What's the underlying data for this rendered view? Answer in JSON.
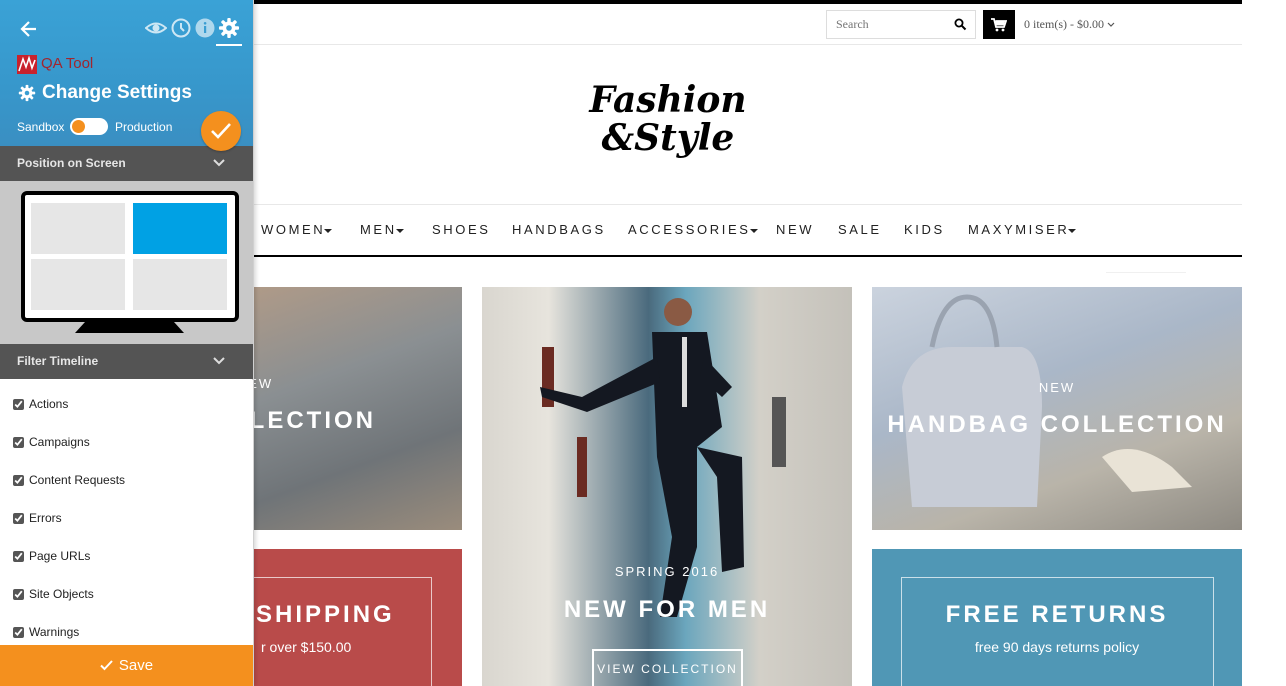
{
  "site": {
    "search_placeholder": "Search",
    "cart_summary": "0 item(s) - $0.00",
    "logo_line1": "Fashion",
    "logo_line2": "&Style",
    "nav": [
      "WOMEN",
      "MEN",
      "SHOES",
      "HANDBAGS",
      "ACCESSORIES",
      "NEW",
      "SALE",
      "KIDS",
      "MAXYMISER"
    ],
    "tiles": {
      "collection": {
        "kicker": "NEW",
        "title": "COLLECTION"
      },
      "men": {
        "kicker": "SPRING 2016",
        "title": "NEW FOR MEN",
        "button": "VIEW COLLECTION"
      },
      "handbag": {
        "kicker": "NEW",
        "title": "HANDBAG COLLECTION"
      },
      "shipping": {
        "title": "SHIPPING",
        "sub": "r over $150.00"
      },
      "returns": {
        "title": "FREE RETURNS",
        "sub": "free 90 days returns policy"
      }
    },
    "colors": {
      "shipping_tile": "#b94b4a",
      "returns_tile": "#5097b5"
    }
  },
  "panel": {
    "tool_name": "QA Tool",
    "title": "Change Settings",
    "env_left": "Sandbox",
    "env_right": "Production",
    "environment_is_production": false,
    "position_section": "Position on Screen",
    "selected_position": "top-right",
    "filter_section": "Filter Timeline",
    "filters": [
      {
        "label": "Actions",
        "checked": true
      },
      {
        "label": "Campaigns",
        "checked": true
      },
      {
        "label": "Content Requests",
        "checked": true
      },
      {
        "label": "Errors",
        "checked": true
      },
      {
        "label": "Page URLs",
        "checked": true
      },
      {
        "label": "Site Objects",
        "checked": true
      },
      {
        "label": "Warnings",
        "checked": true
      }
    ],
    "save_label": "Save",
    "icons": [
      "back-arrow-icon",
      "eye-icon",
      "clock-icon",
      "info-icon",
      "gear-icon"
    ],
    "colors": {
      "header": "#3aa2d6",
      "accent": "#f4901e",
      "section_bar": "#545454",
      "selected_cell": "#00a1e4"
    }
  }
}
